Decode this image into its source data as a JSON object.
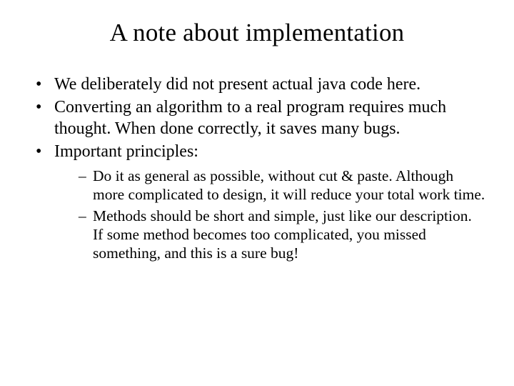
{
  "title": "A note about implementation",
  "bullets": [
    "We deliberately did not present actual java code here.",
    "Converting an algorithm to a real program requires much thought. When done correctly, it saves many bugs.",
    "Important principles:"
  ],
  "sub_bullets": [
    "Do it as general as possible, without cut & paste. Although more complicated to design, it will reduce your total work time.",
    "Methods should be short and simple, just like our description. If some method becomes too complicated, you missed something, and this is a sure bug!"
  ]
}
